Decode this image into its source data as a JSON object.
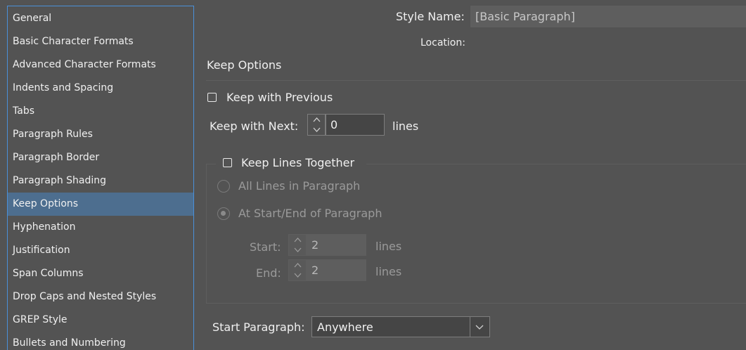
{
  "sidebar": {
    "items": [
      {
        "label": "General"
      },
      {
        "label": "Basic Character Formats"
      },
      {
        "label": "Advanced Character Formats"
      },
      {
        "label": "Indents and Spacing"
      },
      {
        "label": "Tabs"
      },
      {
        "label": "Paragraph Rules"
      },
      {
        "label": "Paragraph Border"
      },
      {
        "label": "Paragraph Shading"
      },
      {
        "label": "Keep Options"
      },
      {
        "label": "Hyphenation"
      },
      {
        "label": "Justification"
      },
      {
        "label": "Span Columns"
      },
      {
        "label": "Drop Caps and Nested Styles"
      },
      {
        "label": "GREP Style"
      },
      {
        "label": "Bullets and Numbering"
      }
    ],
    "active_label": "Keep Options"
  },
  "header": {
    "style_name_label": "Style Name:",
    "style_name_value": "[Basic Paragraph]",
    "location_label": "Location:"
  },
  "section": {
    "title": "Keep Options"
  },
  "keep_with_previous": {
    "label": "Keep with Previous",
    "checked": false
  },
  "keep_with_next": {
    "label": "Keep with Next:",
    "value": "0",
    "unit": "lines"
  },
  "keep_lines_together": {
    "label": "Keep Lines Together",
    "checked": false,
    "all_lines_label": "All Lines in Paragraph",
    "start_end_label": "At Start/End of Paragraph",
    "start_label": "Start:",
    "start_value": "2",
    "start_unit": "lines",
    "end_label": "End:",
    "end_value": "2",
    "end_unit": "lines"
  },
  "start_paragraph": {
    "label": "Start Paragraph:",
    "value": "Anywhere"
  },
  "colors": {
    "background": "#535353",
    "active_item": "#4d6e8f",
    "focus_border": "#4a90d9"
  }
}
